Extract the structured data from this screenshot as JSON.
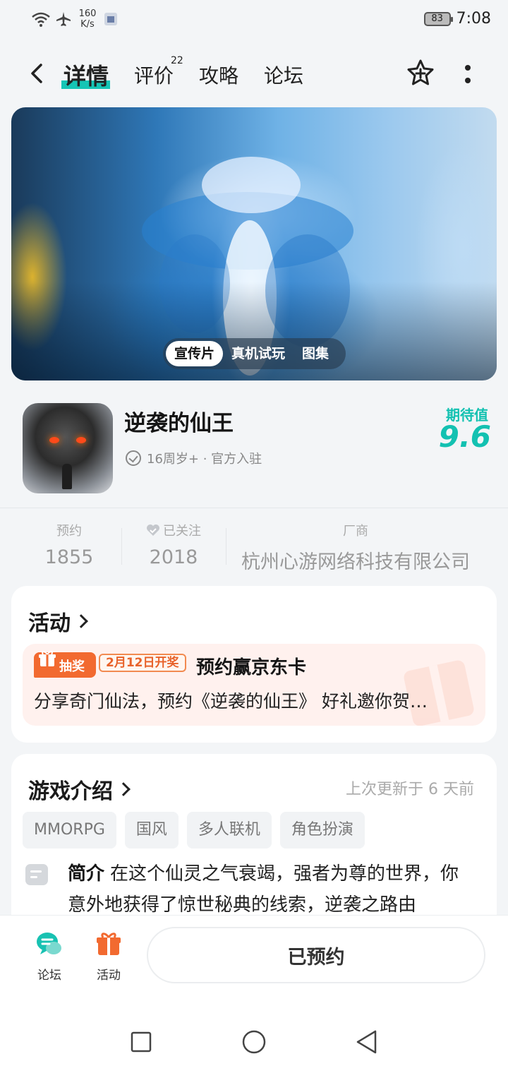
{
  "status_bar": {
    "speed": "160\nK/s",
    "speed_top": "160",
    "speed_unit": "K/s",
    "battery": "83",
    "time": "7:08"
  },
  "nav": {
    "tabs": [
      {
        "label": "详情",
        "active": true
      },
      {
        "label": "评价",
        "badge": "22"
      },
      {
        "label": "攻略"
      },
      {
        "label": "论坛"
      }
    ]
  },
  "hero": {
    "media_tabs": [
      "宣传片",
      "真机试玩",
      "图集"
    ],
    "active_media": "宣传片"
  },
  "game": {
    "title": "逆袭的仙王",
    "meta": "16周岁+ · 官方入驻",
    "expect_label": "期待值",
    "expect_value": "9.6"
  },
  "stats": [
    {
      "label": "预约",
      "value": "1855"
    },
    {
      "label": "已关注",
      "value": "2018"
    },
    {
      "label": "厂商",
      "value": "杭州心游网络科技有限公司"
    }
  ],
  "activity_card": {
    "title": "活动",
    "badge": "抽奖",
    "date": "2月12日开奖",
    "headline": "预约赢京东卡",
    "desc": "分享奇门仙法，预约《逆袭的仙王》 好礼邀你贺…"
  },
  "intro_card": {
    "title": "游戏介绍",
    "updated": "上次更新于 6 天前",
    "tags": [
      "MMORPG",
      "国风",
      "多人联机",
      "角色扮演"
    ],
    "intro_label": "简介",
    "intro_text": "在这个仙灵之气衰竭，强者为尊的世界，你意外地获得了惊世秘典的线索，逆袭之路由"
  },
  "bottom_bar": {
    "forum_label": "论坛",
    "activity_label": "活动",
    "reserved_label": "已预约"
  },
  "colors": {
    "accent": "#13c1b1",
    "orange": "#f26a30"
  }
}
